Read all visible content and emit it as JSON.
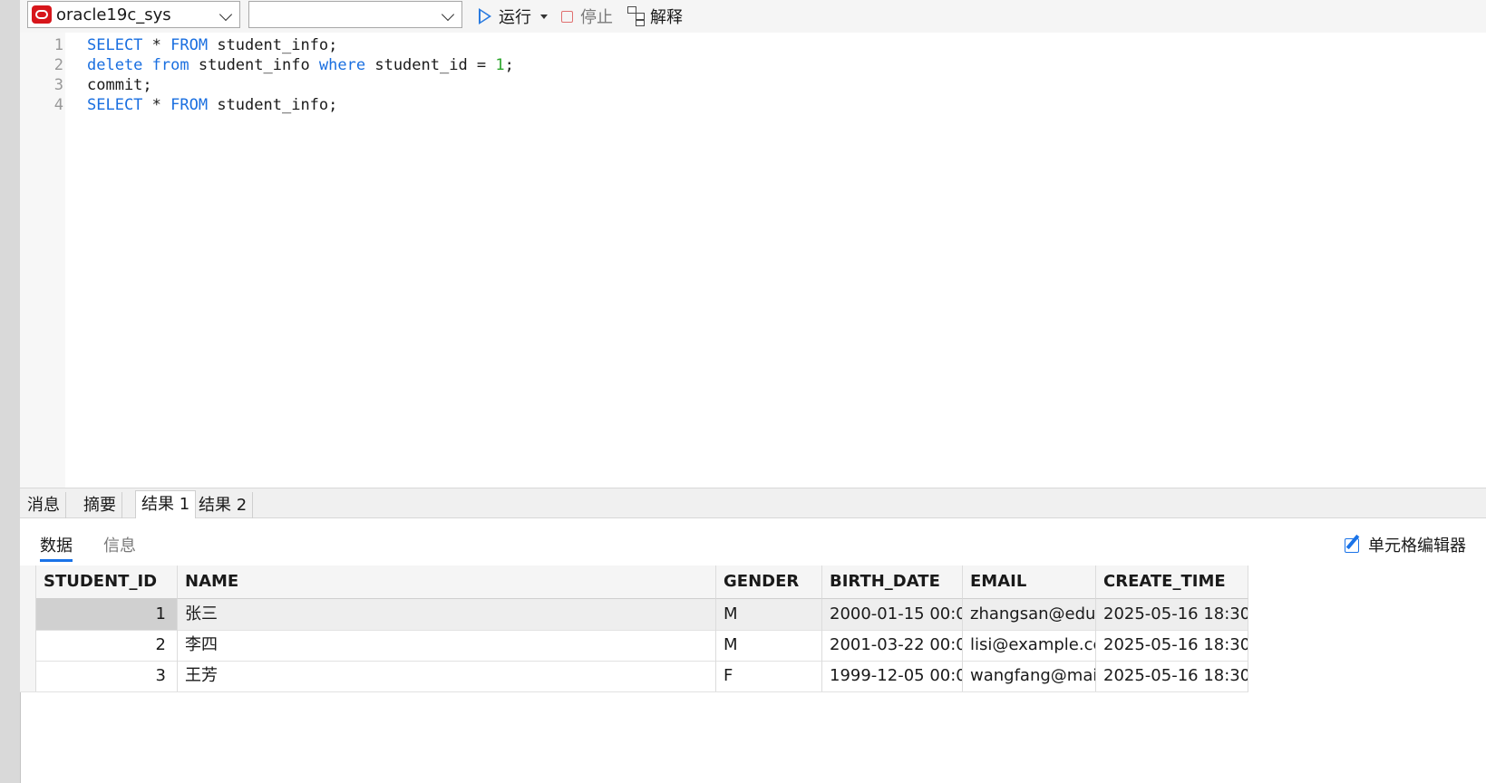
{
  "toolbar": {
    "connection": "oracle19c_sys",
    "schema": "",
    "run_label": "运行",
    "stop_label": "停止",
    "explain_label": "解释"
  },
  "editor": {
    "lines": [
      {
        "num": "1",
        "tokens": [
          {
            "t": "SELECT",
            "k": "kw"
          },
          {
            "t": " * ",
            "k": ""
          },
          {
            "t": "FROM",
            "k": "kw"
          },
          {
            "t": " student_info;",
            "k": ""
          }
        ]
      },
      {
        "num": "2",
        "tokens": [
          {
            "t": "delete",
            "k": "kw"
          },
          {
            "t": " ",
            "k": ""
          },
          {
            "t": "from",
            "k": "kw"
          },
          {
            "t": " student_info ",
            "k": ""
          },
          {
            "t": "where",
            "k": "kw"
          },
          {
            "t": " student_id = ",
            "k": ""
          },
          {
            "t": "1",
            "k": "num"
          },
          {
            "t": ";",
            "k": ""
          }
        ]
      },
      {
        "num": "3",
        "tokens": [
          {
            "t": "commit;",
            "k": ""
          }
        ]
      },
      {
        "num": "4",
        "tokens": [
          {
            "t": "SELECT",
            "k": "kw"
          },
          {
            "t": " * ",
            "k": ""
          },
          {
            "t": "FROM",
            "k": "kw"
          },
          {
            "t": " student_info;",
            "k": ""
          }
        ]
      }
    ]
  },
  "result_tabs": [
    "消息",
    "摘要",
    "结果 1",
    "结果 2"
  ],
  "sub_tabs": {
    "data": "数据",
    "info": "信息"
  },
  "cell_editor_label": "单元格编辑器",
  "grid": {
    "columns": [
      "STUDENT_ID",
      "NAME",
      "GENDER",
      "BIRTH_DATE",
      "EMAIL",
      "CREATE_TIME"
    ],
    "rows": [
      [
        "1",
        "张三",
        "M",
        "2000-01-15 00:0",
        "zhangsan@edu",
        "2025-05-16 18:30"
      ],
      [
        "2",
        "李四",
        "M",
        "2001-03-22 00:0",
        "lisi@example.cc",
        "2025-05-16 18:30"
      ],
      [
        "3",
        "王芳",
        "F",
        "1999-12-05 00:0",
        "wangfang@mai",
        "2025-05-16 18:30"
      ]
    ]
  }
}
